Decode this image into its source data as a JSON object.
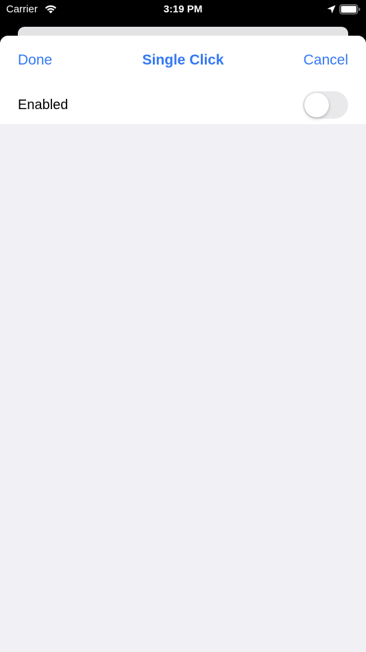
{
  "status_bar": {
    "carrier": "Carrier",
    "time": "3:19 PM",
    "wifi_icon": "wifi-icon",
    "location_icon": "location-arrow-icon",
    "battery_icon": "battery-full-icon"
  },
  "nav": {
    "done_label": "Done",
    "title": "Single Click",
    "cancel_label": "Cancel"
  },
  "settings": {
    "rows": [
      {
        "label": "Enabled",
        "toggle_on": false
      }
    ]
  },
  "colors": {
    "accent": "#3478f6",
    "sheet_background": "#f0f0f5",
    "toggle_off": "#e9e9eb"
  }
}
